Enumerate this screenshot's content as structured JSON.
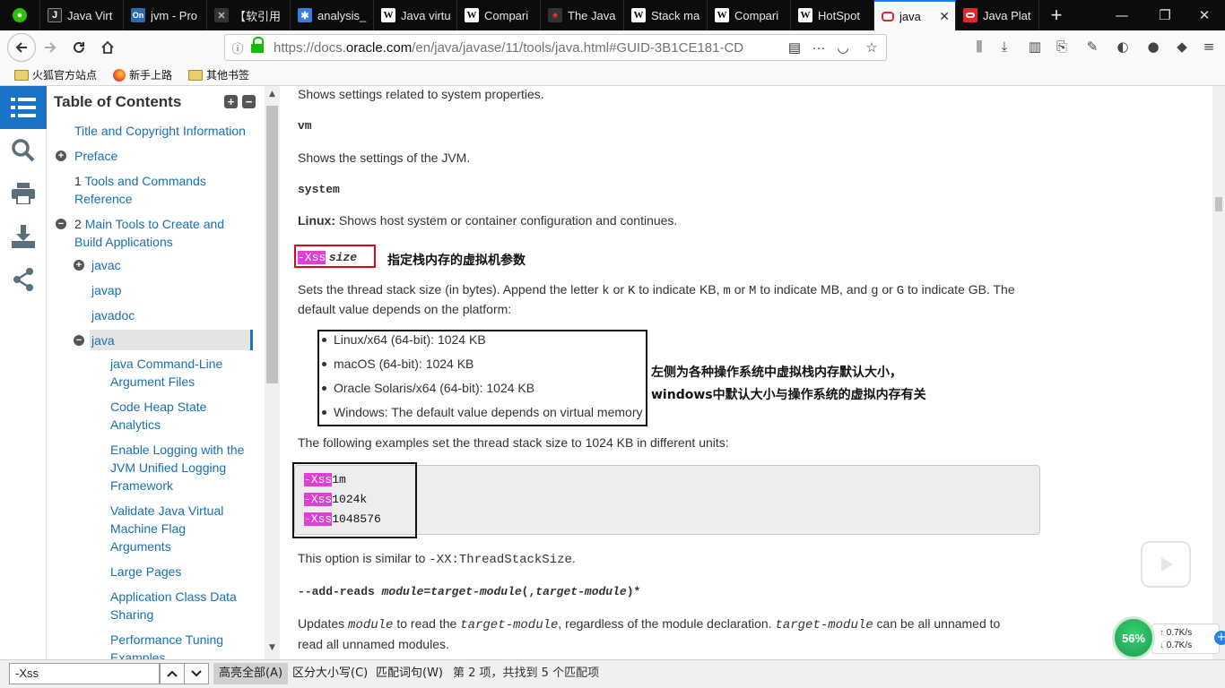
{
  "tabs": [
    {
      "title": "",
      "favicon": "wechat-icon",
      "color": "#2dc100"
    },
    {
      "title": "Java Virt",
      "favicon": "J",
      "color": "#222222"
    },
    {
      "title": "jvm - Pro",
      "favicon": "On",
      "color": "#2b6cb0"
    },
    {
      "title": "【软引用",
      "favicon": "cat",
      "color": "#444444"
    },
    {
      "title": "analysis_",
      "favicon": "grid",
      "color": "#3d7bd9"
    },
    {
      "title": "Java virtu",
      "favicon": "W",
      "color": "#ffffff"
    },
    {
      "title": "Compari",
      "favicon": "W",
      "color": "#ffffff"
    },
    {
      "title": "The Java",
      "favicon": "duke",
      "color": "#333333"
    },
    {
      "title": "Stack ma",
      "favicon": "W",
      "color": "#ffffff"
    },
    {
      "title": "Compari",
      "favicon": "W",
      "color": "#ffffff"
    },
    {
      "title": "HotSpot",
      "favicon": "W",
      "color": "#ffffff"
    },
    {
      "title": "java",
      "favicon": "oracle",
      "color": "#e5262d",
      "active": true
    },
    {
      "title": "Java Plat",
      "favicon": "oracle",
      "color": "#e5262d"
    }
  ],
  "newtab": "+",
  "url": {
    "prefix": "https://docs.",
    "domain": "oracle.com",
    "path": "/en/java/javase/11/tools/java.html#GUID-3B1CE181-CD"
  },
  "bookmarks": [
    "火狐官方站点",
    "新手上路",
    "其他书签"
  ],
  "toc": {
    "header": "Table of Contents",
    "items": [
      {
        "text": "Title and Copyright Information"
      },
      {
        "text": "Preface"
      },
      {
        "num": "1",
        "line1": "Tools and Commands",
        "line2": "Reference"
      },
      {
        "num": "2",
        "line1": "Main Tools to Create and",
        "line2": "Build Applications"
      },
      {
        "text": "javac"
      },
      {
        "text": "javap"
      },
      {
        "text": "javadoc"
      },
      {
        "text": "java"
      },
      {
        "line1": "java Command-Line",
        "line2": "Argument Files"
      },
      {
        "line1": "Code Heap State",
        "line2": "Analytics"
      },
      {
        "line1": "Enable Logging with the",
        "line2": "JVM Unified Logging",
        "line3": "Framework"
      },
      {
        "line1": "Validate Java Virtual",
        "line2": "Machine Flag",
        "line3": "Arguments"
      },
      {
        "text": "Large Pages"
      },
      {
        "line1": "Application Class Data",
        "line2": "Sharing"
      },
      {
        "line1": "Performance Tuning",
        "line2": "Examples"
      }
    ]
  },
  "content": {
    "p_sysprops": "Shows settings related to system properties.",
    "vm": "vm",
    "p_vm": "Shows the settings of the JVM.",
    "system": "system",
    "linux_label": "Linux:",
    "linux_text": " Shows host system or container configuration and continues.",
    "xss_opt": "-Xss",
    "xss_arg": "size",
    "note1": "指定栈内存的虚拟机参数",
    "p_sets_1": "Sets the thread stack size (in bytes). Append the letter ",
    "k": "k",
    "or1": " or ",
    "K": "K",
    "p_sets_2": " to indicate KB, ",
    "m": "m",
    "or2": " or ",
    "M": "M",
    "p_sets_3": " to indicate MB, and ",
    "g": "g",
    "or3": " or ",
    "G": "G",
    "p_sets_4": " to indicate GB. The",
    "p_sets_line2": "default value depends on the platform:",
    "defaults": [
      "Linux/x64 (64-bit): 1024 KB",
      "macOS (64-bit): 1024 KB",
      "Oracle Solaris/x64 (64-bit): 1024 KB",
      "Windows: The default value depends on virtual memory"
    ],
    "note2_line1": "左侧为各种操作系统中虚拟栈内存默认大小，",
    "note2_line2": "windows中默认大小与操作系统的虚拟内存有关",
    "p_examples": "The following examples set the thread stack size to 1024 KB in different units:",
    "code": [
      {
        "opt": "-Xss",
        "val": "1m"
      },
      {
        "opt": "-Xss",
        "val": "1024k"
      },
      {
        "opt": "-Xss",
        "val": "1048576"
      }
    ],
    "similar_1": "This option is similar to ",
    "similar_code": "-XX:ThreadStackSize",
    "similar_2": ".",
    "addreads_1": "--add-reads ",
    "addreads_2": "module",
    "addreads_3": "=",
    "addreads_4": "target-module",
    "addreads_5": "(,",
    "addreads_6": "target-module",
    "addreads_7": ")*",
    "upd_1": "Updates ",
    "upd_module": "module",
    "upd_2": " to read the ",
    "upd_target": "target-module",
    "upd_3": ", regardless of the module declaration. ",
    "upd_target2": "target-module",
    "upd_4": " can be all unnamed to",
    "upd_line2": "read all unnamed modules."
  },
  "findbar": {
    "value": "-Xss",
    "highlight_all": "高亮全部(A)",
    "match_case": "区分大小写(C)",
    "whole_words": "匹配词句(W)",
    "status": "第 2 项，共找到 5 个匹配项"
  },
  "netwidget": {
    "percent": "56%",
    "up": "0.7K/s",
    "down": "0.7K/s"
  }
}
